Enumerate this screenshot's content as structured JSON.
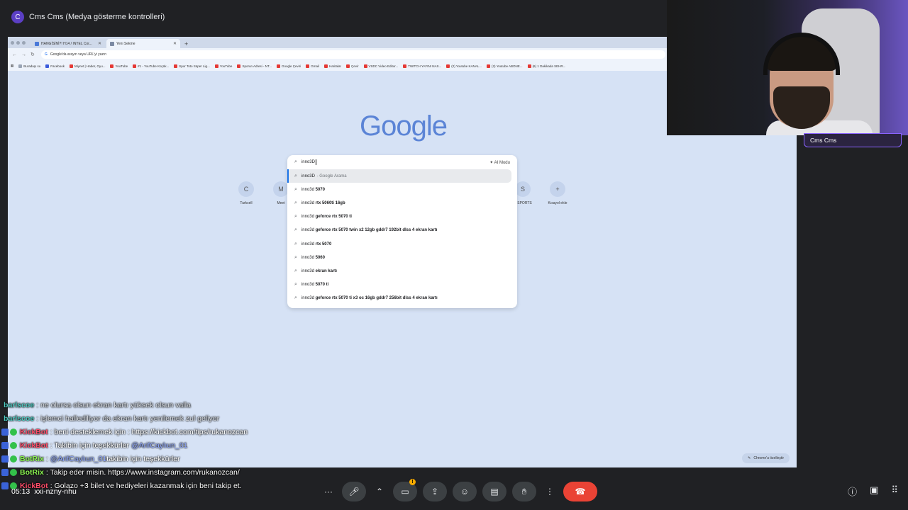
{
  "meeting": {
    "title": "Cms Cms (Medya gösterme kontrolleri)",
    "avatar_letter": "C",
    "presenter_name": "Cms Cms",
    "time": "05:13",
    "code": "xxi-nzny-nhu"
  },
  "browser": {
    "tabs": [
      {
        "label": "HANGİSİNİ?! H14 / INTEL Cor..."
      },
      {
        "label": "Yeni Sekme"
      }
    ],
    "omnibox_placeholder": "Google'da arayın veya URL'yi yazın",
    "bookmarks": [
      "Buradaşı su",
      "Facebook",
      "Miynet | Haber, Oyu...",
      "YouTube",
      "#1 - YouTube Küçük...",
      "Spor Toto Süper Lig...",
      "YouTube",
      "Sporun Adresi - NT...",
      "Google Çeviri",
      "Gmail",
      "Haritalar",
      "Çevir",
      "VSDC Video Editor...",
      "TWITCH YAYINI NAS...",
      "(2) Youtube KANAL...",
      "(2) Youtube ABONE...",
      "(6) 1 Dakikada SEHR..."
    ],
    "logo": "Google",
    "search_query": "inno3D",
    "ai_mode_label": "AI Modu",
    "suggestions": [
      {
        "prefix": "inno3D",
        "bold": "",
        "suffix": " - Google Arama"
      },
      {
        "prefix": "inno3d ",
        "bold": "5070",
        "suffix": ""
      },
      {
        "prefix": "inno3d ",
        "bold": "rtx 5060ti 16gb",
        "suffix": ""
      },
      {
        "prefix": "inno3d ",
        "bold": "geforce rtx 5070 ti",
        "suffix": ""
      },
      {
        "prefix": "inno3d ",
        "bold": "geforce rtx 5070 twin x2 12gb gddr7 192bit dlss 4 ekran kartı",
        "suffix": ""
      },
      {
        "prefix": "inno3d ",
        "bold": "rtx 5070",
        "suffix": ""
      },
      {
        "prefix": "inno3d ",
        "bold": "5060",
        "suffix": ""
      },
      {
        "prefix": "inno3d ",
        "bold": "ekran kartı",
        "suffix": ""
      },
      {
        "prefix": "inno3d ",
        "bold": "5070 ti",
        "suffix": ""
      },
      {
        "prefix": "inno3d ",
        "bold": "geforce rtx 5070 ti x3 oc 16gb gddr7 256bit dlss 4 ekran kartı",
        "suffix": ""
      }
    ],
    "shortcuts": [
      {
        "label": "Turkcell",
        "icon": "C"
      },
      {
        "label": "Meet",
        "icon": "M"
      },
      {
        "label": "N SPORTS",
        "icon": "S"
      },
      {
        "label": "Kısayol ekle",
        "icon": "+"
      }
    ],
    "customize_label": "Chrome'u özelleştir"
  },
  "chat": [
    {
      "user": "barlscoe",
      "user_color": "#4ec9c0",
      "text": ": ne olursa olsun ekran kartı yüksek olsun valla",
      "badges": []
    },
    {
      "user": "barlscoe",
      "user_color": "#4ec9c0",
      "text": ": işlemci hallediliyor da ekran kartı yenilemek zul geliyor",
      "badges": []
    },
    {
      "user": "KickBot",
      "user_color": "#ff4d6a",
      "text": ": beni desteklemek için : https://kickbot.com/tips/rukanozcan",
      "badges": [
        "kick",
        "check"
      ]
    },
    {
      "user": "KickBot",
      "user_color": "#ff4d6a",
      "text": ": Takibin için teşekkürler",
      "mention": "@ArifCaylıun_01",
      "badges": [
        "kick",
        "check"
      ]
    },
    {
      "user": "BotRix",
      "user_color": "#8bf552",
      "text": ":",
      "mention": "@ArifCaylıun_01",
      "text2": " takibin için teşekkürler",
      "badges": [
        "kick",
        "check"
      ]
    },
    {
      "user": "BotRix",
      "user_color": "#8bf552",
      "text": ": Takip eder misin. https://www.instagram.com/rukanozcan/",
      "badges": [
        "kick",
        "check"
      ]
    },
    {
      "user": "KickBot",
      "user_color": "#ff4d6a",
      "text": ": Golazo +3 bilet ve hediyeleri kazanmak için beni takip et.",
      "badges": [
        "kick",
        "check"
      ]
    }
  ],
  "colors": {
    "accent": "#8a63ff",
    "end_call": "#ea4335",
    "screen_bg": "#d6e2f5"
  }
}
